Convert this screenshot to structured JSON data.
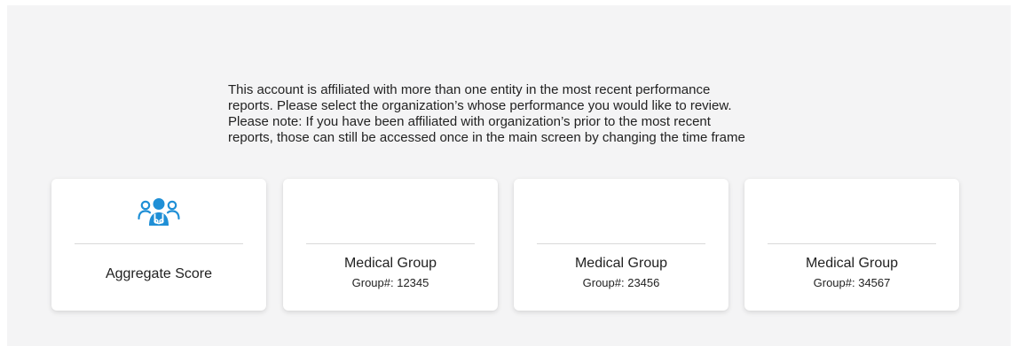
{
  "message": {
    "lines": [
      "This account is affiliated with more than one entity in the most recent performance",
      "reports. Please select the organization’s whose performance you would like to review.",
      "Please note: If you have been affiliated with organization’s prior to the most recent",
      "reports, those can still be accessed once in the main screen by changing the time frame"
    ]
  },
  "cards": [
    {
      "icon": "medical-team-icon",
      "title": "Aggregate Score"
    },
    {
      "title": "Medical Group",
      "subtitle": "Group#: 12345"
    },
    {
      "title": "Medical Group",
      "subtitle": "Group#: 23456"
    },
    {
      "title": "Medical Group",
      "subtitle": "Group#: 34567"
    }
  ],
  "colors": {
    "background": "#f4f4f5",
    "card": "#ffffff",
    "accent": "#1f8fd6",
    "text": "#222222",
    "divider": "#d9d9d9"
  }
}
